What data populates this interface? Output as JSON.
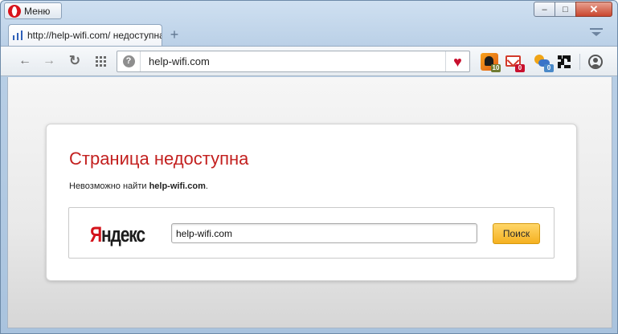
{
  "window": {
    "menu_label": "Меню",
    "minimize": "–",
    "maximize": "□",
    "close": "✕"
  },
  "tabs": [
    {
      "title": "http://help-wifi.com/ недоступна",
      "favicon": "signal-bars-icon",
      "active": true
    }
  ],
  "toolbar": {
    "back": "←",
    "forward": "→",
    "reload": "↻",
    "address": "help-wifi.com",
    "site_info": "?",
    "bookmark": "♥",
    "extensions": [
      {
        "name": "photo-extension-icon",
        "badge": "10"
      },
      {
        "name": "mail-extension-icon",
        "badge": "0"
      },
      {
        "name": "weather-extension-icon",
        "badge": "0"
      },
      {
        "name": "qr-code-icon",
        "badge": ""
      }
    ]
  },
  "page": {
    "title": "Страница недоступна",
    "message_prefix": "Невозможно найти ",
    "message_host": "help-wifi.com",
    "message_suffix": ".",
    "search": {
      "logo_first": "Я",
      "logo_rest": "ндекс",
      "query": "help-wifi.com",
      "button": "Поиск"
    }
  },
  "colors": {
    "error_title": "#c3201f",
    "search_button": "#f5b120",
    "bookmark_heart": "#c8102e"
  }
}
